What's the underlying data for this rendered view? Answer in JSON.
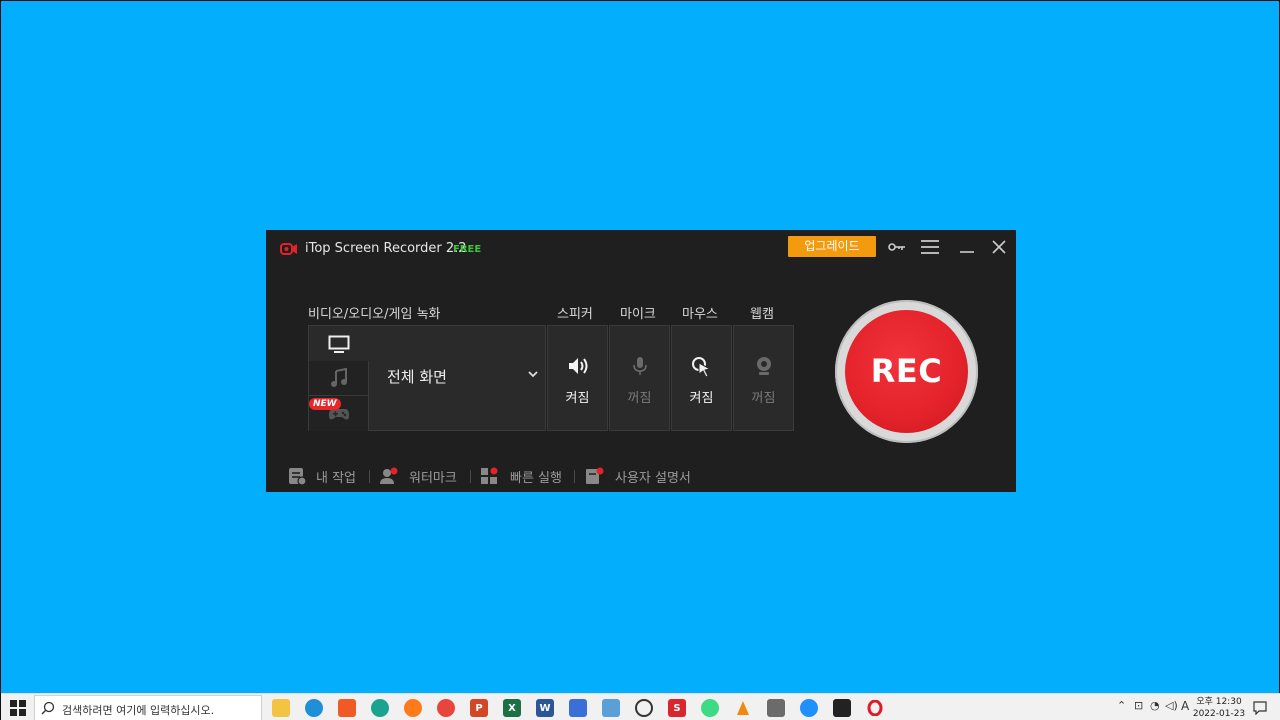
{
  "app": {
    "title": "iTop Screen Recorder 2.2",
    "edition": "FREE",
    "upgrade_label": "업그레이드",
    "mode_section_label": "비디오/오디오/게임 녹화",
    "mode_value": "전체 화면",
    "new_badge": "NEW",
    "toggles": [
      {
        "label": "스피커",
        "state": "켜짐",
        "icon": "speaker-icon",
        "on": true
      },
      {
        "label": "마이크",
        "state": "꺼짐",
        "icon": "microphone-icon",
        "on": false
      },
      {
        "label": "마우스",
        "state": "켜짐",
        "icon": "mouse-click-icon",
        "on": true
      },
      {
        "label": "웹캠",
        "state": "꺼짐",
        "icon": "webcam-icon",
        "on": false
      }
    ],
    "rec_label": "REC",
    "footer": {
      "my_work": "내 작업",
      "watermark": "워터마크",
      "quick_launch": "빠른 실행",
      "user_guide": "사용자 설명서"
    },
    "colors": {
      "accent_red": "#e3222a",
      "upgrade_orange": "#f49a0f",
      "free_green": "#3cc43c",
      "desktop": "#03aefc"
    }
  },
  "taskbar": {
    "search_placeholder": "검색하려면 여기에 입력하십시오.",
    "apps": [
      "file-explorer-icon",
      "edge-icon",
      "brave-icon",
      "app-icon",
      "firefox-icon",
      "chrome-icon",
      "powerpoint-icon",
      "excel-icon",
      "word-icon",
      "app-icon",
      "app-icon",
      "search-app-icon",
      "app-icon",
      "android-icon",
      "vlc-icon",
      "calculator-icon",
      "chrome-icon",
      "notes-icon",
      "opera-icon"
    ],
    "ime": "A",
    "time": "오후 12:30",
    "date": "2022-01-23"
  }
}
